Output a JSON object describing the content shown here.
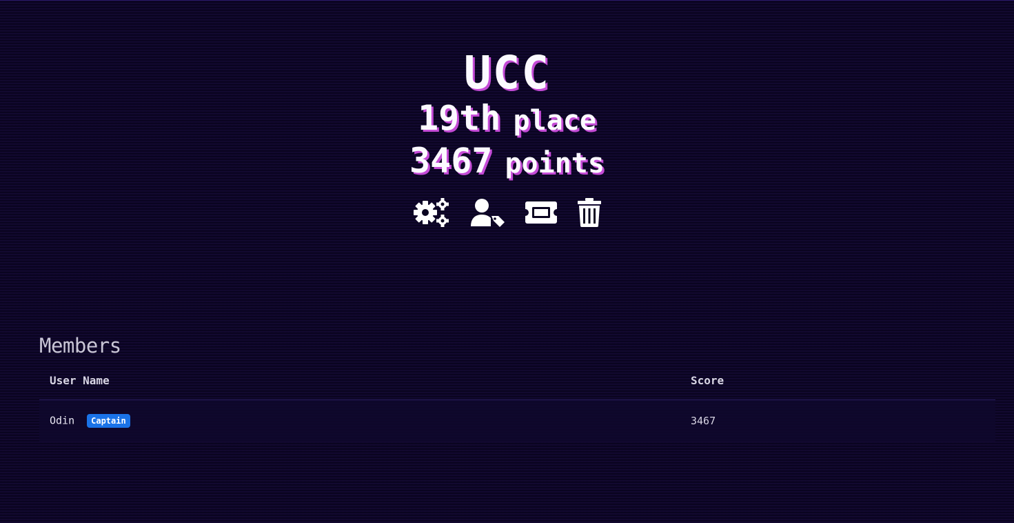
{
  "team": {
    "name": "UCC",
    "place_value": "19th",
    "place_word": "place",
    "points_value": "3467",
    "points_word": "points"
  },
  "actions": [
    {
      "icon": "gears-icon"
    },
    {
      "icon": "user-tag-icon"
    },
    {
      "icon": "ticket-icon"
    },
    {
      "icon": "trash-icon"
    }
  ],
  "members": {
    "heading": "Members",
    "columns": [
      "User Name",
      "Score"
    ],
    "rows": [
      {
        "name": "Odin",
        "badge": "Captain",
        "score": "3467"
      }
    ]
  },
  "colors": {
    "background": "#0a0420",
    "title_shadow": "#c44bd6",
    "badge": "#1a73e8"
  }
}
